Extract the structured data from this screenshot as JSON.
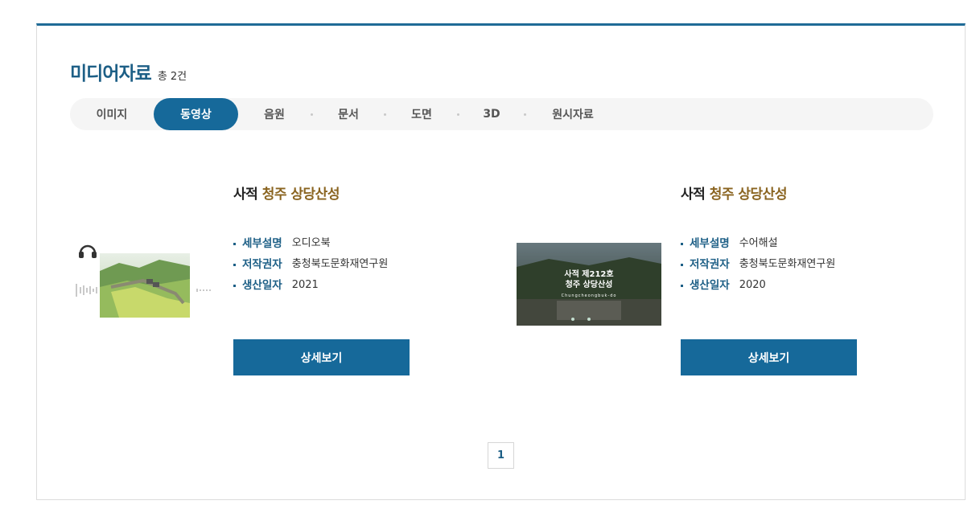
{
  "section": {
    "title": "미디어자료",
    "count": "총 2건"
  },
  "tabs": [
    {
      "label": "이미지",
      "active": false
    },
    {
      "label": "동영상",
      "active": true
    },
    {
      "label": "음원",
      "active": false
    },
    {
      "label": "문서",
      "active": false
    },
    {
      "label": "도면",
      "active": false
    },
    {
      "label": "3D",
      "active": false
    },
    {
      "label": "원시자료",
      "active": false
    }
  ],
  "items": [
    {
      "title_prefix": "사적",
      "title_highlight": "청주 상당산성",
      "details": [
        {
          "label": "세부설명",
          "value": "오디오북"
        },
        {
          "label": "저작권자",
          "value": "충청북도문화재연구원"
        },
        {
          "label": "생산일자",
          "value": "2021"
        }
      ],
      "button": "상세보기"
    },
    {
      "title_prefix": "사적",
      "title_highlight": "청주 상당산성",
      "details": [
        {
          "label": "세부설명",
          "value": "수어해설"
        },
        {
          "label": "저작권자",
          "value": "충청북도문화재연구원"
        },
        {
          "label": "생산일자",
          "value": "2020"
        }
      ],
      "button": "상세보기",
      "thumb_text": {
        "line1": "사적 제212호",
        "line2": "청주 상당산성",
        "line3": "Chungcheongbuk-do"
      }
    }
  ],
  "pagination": {
    "current": "1"
  },
  "colors": {
    "accent": "#16699a",
    "title": "#1d5f86",
    "highlight": "#8a6420"
  }
}
